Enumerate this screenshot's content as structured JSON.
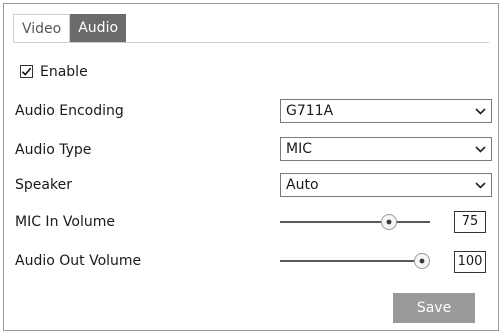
{
  "tabs": [
    {
      "label": "Video",
      "active": false
    },
    {
      "label": "Audio",
      "active": true
    }
  ],
  "enable": {
    "label": "Enable",
    "checked": true
  },
  "fields": {
    "audio_encoding": {
      "label": "Audio Encoding",
      "value": "G711A"
    },
    "audio_type": {
      "label": "Audio Type",
      "value": "MIC"
    },
    "speaker": {
      "label": "Speaker",
      "value": "Auto"
    },
    "mic_in_volume": {
      "label": "MIC In Volume",
      "value": "75",
      "level": 0.75
    },
    "audio_out_volume": {
      "label": "Audio Out Volume",
      "value": "100",
      "level": 1.0
    }
  },
  "save_label": "Save",
  "colors": {
    "active_tab": "#6b6b6b",
    "save_button": "#9a9a9a",
    "border": "#9a9a9a"
  },
  "icons": {
    "checkbox": "checkmark-icon",
    "dropdown": "chevron-down-icon",
    "slider": "slider-thumb"
  }
}
